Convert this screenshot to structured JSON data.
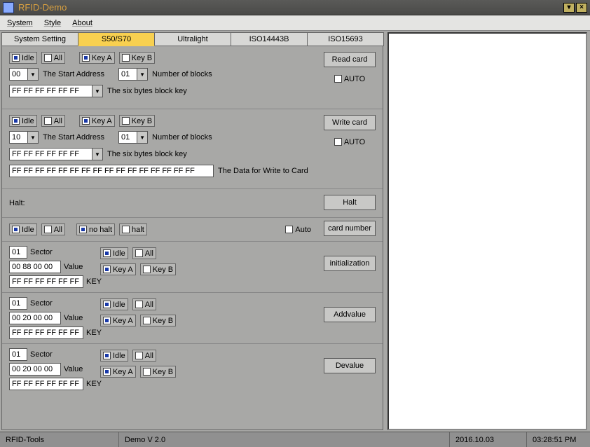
{
  "window": {
    "title": "RFID-Demo",
    "minimize": "▾",
    "close": "×"
  },
  "menu": {
    "system": "System",
    "style": "Style",
    "about": "About"
  },
  "tabs": {
    "t0": "System Setting",
    "t1": "S50/S70",
    "t2": "Ultralight",
    "t3": "ISO14443B",
    "t4": "ISO15693"
  },
  "common": {
    "idle": "Idle",
    "all": "All",
    "keya": "Key A",
    "keyb": "Key B",
    "start_addr": "The Start Address",
    "num_blocks": "Number of blocks",
    "six_bytes": "The six bytes block key",
    "auto_cap": "AUTO",
    "auto": "Auto",
    "nohalt": "no halt",
    "halt_chk": "halt",
    "sector": "Sector",
    "value": "Value",
    "key": "KEY"
  },
  "read": {
    "addr": "00",
    "nblk": "01",
    "key": "FF FF FF FF FF FF",
    "btn": "Read card"
  },
  "write": {
    "addr": "10",
    "nblk": "01",
    "key": "FF FF FF FF FF FF",
    "data": "FF FF FF FF FF FF FF FF FF FF FF FF FF FF FF FF",
    "data_lbl": "The Data for Write to Card",
    "btn": "Write card"
  },
  "halt": {
    "label": "Halt:",
    "btn": "Halt"
  },
  "cardnum": {
    "btn": "card number"
  },
  "init": {
    "sector": "01",
    "value": "00 88 00 00",
    "key": "FF FF FF FF FF FF",
    "btn": "initialization"
  },
  "addv": {
    "sector": "01",
    "value": "00 20 00 00",
    "key": "FF FF FF FF FF FF",
    "btn": "Addvalue"
  },
  "dev": {
    "sector": "01",
    "value": "00 20 00 00",
    "key": "FF FF FF FF FF FF",
    "btn": "Devalue"
  },
  "status": {
    "s0": "RFID-Tools",
    "s1": "Demo  V 2.0",
    "date": "2016.10.03",
    "time": "03:28:51 PM"
  }
}
